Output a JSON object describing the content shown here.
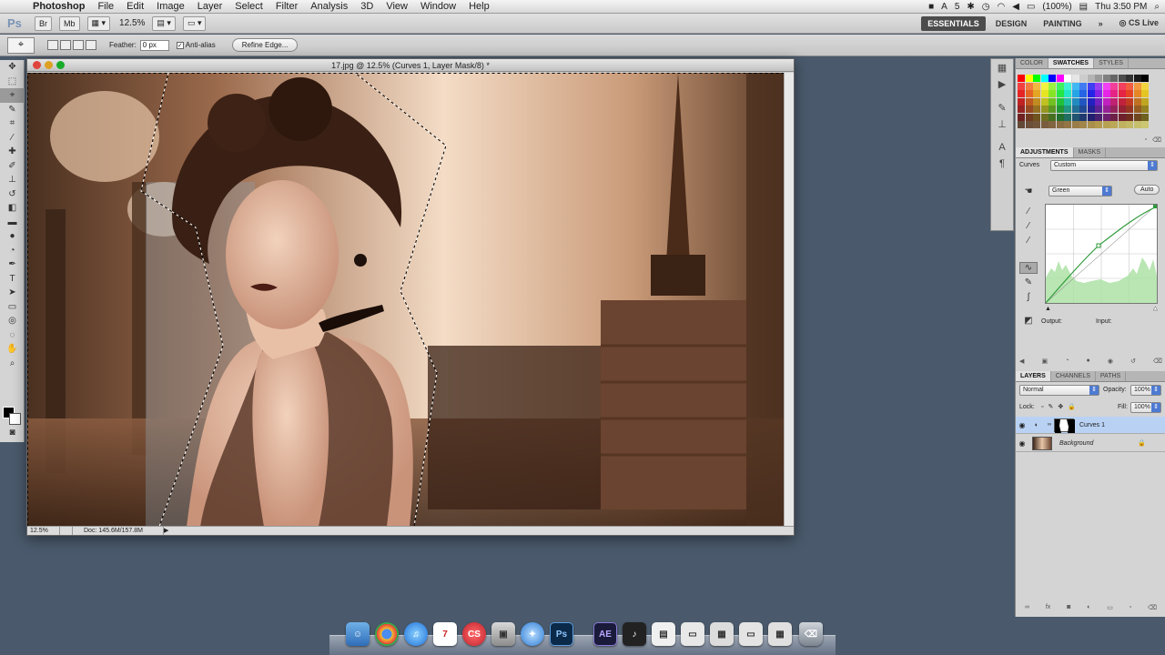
{
  "menubar": {
    "app_name": "Photoshop",
    "items": [
      "File",
      "Edit",
      "Image",
      "Layer",
      "Select",
      "Filter",
      "Analysis",
      "3D",
      "View",
      "Window",
      "Help"
    ],
    "status_num": "5",
    "battery": "(100%)",
    "clock": "Thu 3:50 PM"
  },
  "appbar": {
    "ps_label": "Ps",
    "zoom": "12.5%",
    "workspaces": [
      "ESSENTIALS",
      "DESIGN",
      "PAINTING"
    ],
    "more": "»",
    "cs_live": "CS Live"
  },
  "options": {
    "feather_label": "Feather:",
    "feather_value": "0 px",
    "antialias_label": "Anti-alias",
    "refine_label": "Refine Edge..."
  },
  "document": {
    "title": "17.jpg @ 12.5% (Curves 1, Layer Mask/8) *",
    "zoom_status": "12.5%",
    "doc_status": "Doc: 145.6M/157.8M"
  },
  "panels": {
    "swatch_tabs": [
      "COLOR",
      "SWATCHES",
      "STYLES"
    ],
    "adj_tabs": [
      "ADJUSTMENTS",
      "MASKS"
    ],
    "curves_label": "Curves",
    "preset_value": "Custom",
    "channel_value": "Green",
    "auto_label": "Auto",
    "output_label": "Output:",
    "input_label": "Input:",
    "layer_tabs": [
      "LAYERS",
      "CHANNELS",
      "PATHS"
    ],
    "blend_mode": "Normal",
    "opacity_label": "Opacity:",
    "opacity_value": "100%",
    "lock_label": "Lock:",
    "fill_label": "Fill:",
    "fill_value": "100%",
    "layers": [
      {
        "name": "Curves 1",
        "selected": true
      },
      {
        "name": "Background",
        "selected": false
      }
    ],
    "curve_color": "#2e9a3a"
  },
  "dock": {
    "ae_label": "AE",
    "ps_label": "Ps",
    "cal_day": "7"
  }
}
